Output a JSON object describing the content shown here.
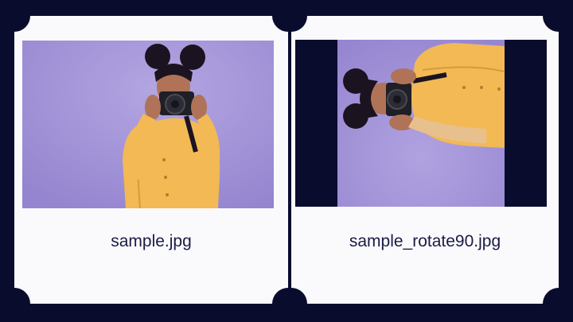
{
  "colors": {
    "background": "#0a0c2e",
    "panel": "#fafafd",
    "caption_text": "#1b1b45",
    "photo_backdrop": "#a697d8",
    "shirt": "#f2b955",
    "hair": "#1b1420",
    "camera": "#1f1f25"
  },
  "panels": [
    {
      "caption": "sample.jpg",
      "image_icon": "photo-woman-with-camera",
      "rotation": "none"
    },
    {
      "caption": "sample_rotate90.jpg",
      "image_icon": "photo-woman-with-camera-rotated",
      "rotation": "90deg"
    }
  ]
}
